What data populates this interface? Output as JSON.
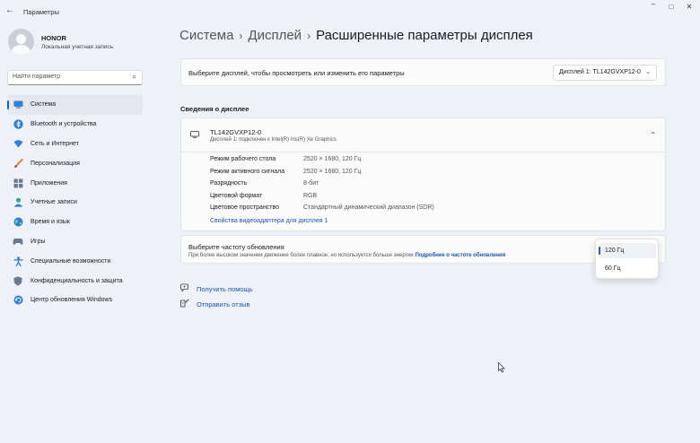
{
  "window": {
    "title": "Параметры",
    "back_glyph": "←",
    "controls": {
      "minimize": "–",
      "maximize": "□",
      "close": "✕"
    }
  },
  "user": {
    "name": "HONOR",
    "account_type": "Локальная учетная запись"
  },
  "search": {
    "placeholder": "Найти параметр",
    "value": ""
  },
  "sidebar": {
    "items": [
      {
        "label": "Система",
        "icon": "system-icon",
        "active": true
      },
      {
        "label": "Bluetooth и устройства",
        "icon": "bluetooth-icon"
      },
      {
        "label": "Сеть и Интернет",
        "icon": "wifi-icon"
      },
      {
        "label": "Персонализация",
        "icon": "brush-icon"
      },
      {
        "label": "Приложения",
        "icon": "apps-icon"
      },
      {
        "label": "Учетные записи",
        "icon": "accounts-icon"
      },
      {
        "label": "Время и язык",
        "icon": "globe-icon"
      },
      {
        "label": "Игры",
        "icon": "gamepad-icon"
      },
      {
        "label": "Специальные возможности",
        "icon": "accessibility-icon"
      },
      {
        "label": "Конфиденциальность и защита",
        "icon": "shield-icon"
      },
      {
        "label": "Центр обновления Windows",
        "icon": "update-icon"
      }
    ]
  },
  "breadcrumb": {
    "items": [
      "Система",
      "Дисплей"
    ],
    "current": "Расширенные параметры дисплея",
    "separator": "›"
  },
  "display_select": {
    "label": "Выберите дисплей, чтобы просмотреть или изменить его параметры",
    "value": "Дисплей 1: TL142GVXP12-0"
  },
  "display_info": {
    "section_title": "Сведения о дисплее",
    "monitor_name": "TL142GVXP12-0",
    "monitor_subtitle": "Дисплей 1: подключен к Intel(R) Iris(R) Xe Graphics",
    "rows": [
      {
        "key": "Режим рабочего стола",
        "value": "2520 × 1680, 120 Гц"
      },
      {
        "key": "Режим активного сигнала",
        "value": "2520 × 1680, 120 Гц"
      },
      {
        "key": "Разрядность",
        "value": "8-бит"
      },
      {
        "key": "Цветовой формат",
        "value": "RGB"
      },
      {
        "key": "Цветовое пространство",
        "value": "Стандартный динамический диапазон (SDR)"
      }
    ],
    "adapter_link": "Свойства видеоадаптера для дисплея 1"
  },
  "refresh_rate": {
    "title": "Выберите частоту обновления",
    "description": "При более высоком значении движение более плавное, но используется больше энергии",
    "more_link": "Подробнее о частоте обновления",
    "options": [
      "120 Гц",
      "60 Гц"
    ],
    "selected": "120 Гц"
  },
  "help": {
    "get_help": "Получить помощь",
    "feedback": "Отправить отзыв"
  },
  "colors": {
    "accent": "#1f5fbf",
    "link": "#1a55b0",
    "background": "#eef1f7"
  }
}
